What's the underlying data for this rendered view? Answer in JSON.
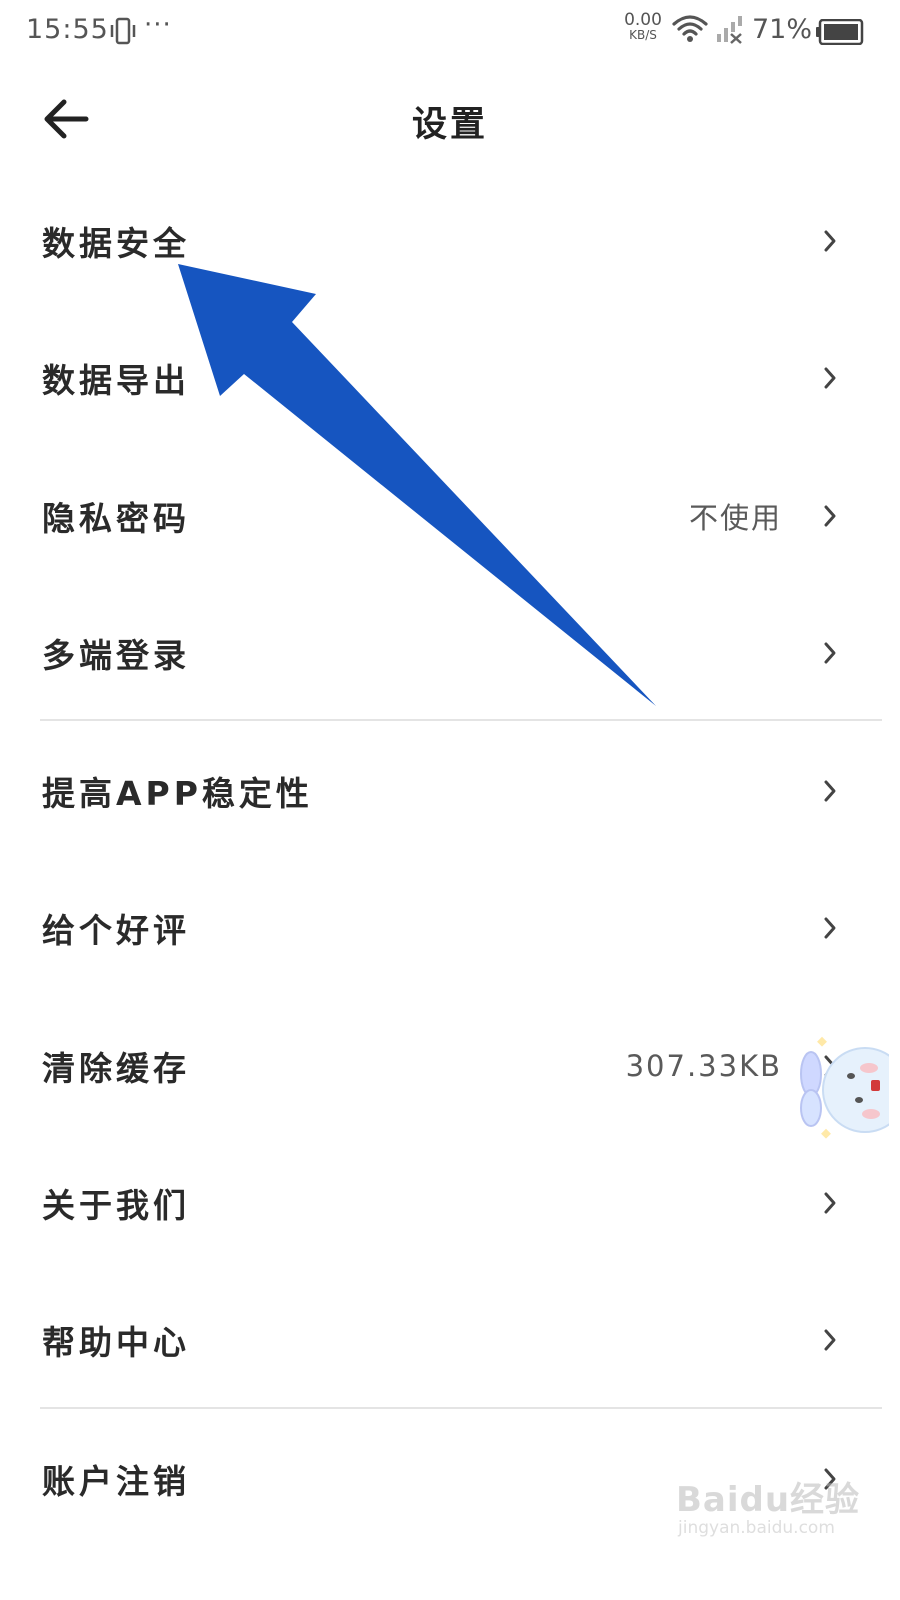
{
  "status_bar": {
    "time": "15:55",
    "more": "···",
    "net_speed_value": "0.00",
    "net_speed_unit": "KB/S",
    "battery_percent": "71%"
  },
  "header": {
    "title": "设置"
  },
  "settings": [
    {
      "label": "数据安全",
      "value": ""
    },
    {
      "label": "数据导出",
      "value": ""
    },
    {
      "label": "隐私密码",
      "value": "不使用"
    },
    {
      "label": "多端登录",
      "value": ""
    },
    {
      "label": "提高APP稳定性",
      "value": ""
    },
    {
      "label": "给个好评",
      "value": ""
    },
    {
      "label": "清除缓存",
      "value": "307.33KB"
    },
    {
      "label": "关于我们",
      "value": ""
    },
    {
      "label": "帮助中心",
      "value": ""
    },
    {
      "label": "账户注销",
      "value": ""
    }
  ],
  "annotation": {
    "color": "#1655c0"
  },
  "watermark": {
    "brand": "Baidu经验",
    "url": "jingyan.baidu.com"
  }
}
